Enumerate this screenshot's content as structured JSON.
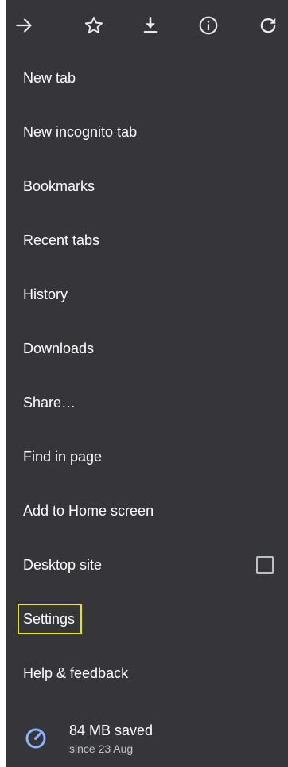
{
  "toolbar": {
    "icons": [
      "forward-arrow-icon",
      "star-icon",
      "download-icon",
      "info-icon",
      "reload-icon"
    ]
  },
  "menu": {
    "items": [
      {
        "label": "New tab"
      },
      {
        "label": "New incognito tab"
      },
      {
        "label": "Bookmarks"
      },
      {
        "label": "Recent tabs"
      },
      {
        "label": "History"
      },
      {
        "label": "Downloads"
      },
      {
        "label": "Share…"
      },
      {
        "label": "Find in page"
      },
      {
        "label": "Add to Home screen"
      },
      {
        "label": "Desktop site",
        "checked": false
      },
      {
        "label": "Settings"
      },
      {
        "label": "Help & feedback"
      }
    ]
  },
  "data_saver": {
    "title": "84 MB saved",
    "subtitle": "since 23 Aug",
    "icon": "speedometer-icon"
  },
  "colors": {
    "menu_background": "#36363a",
    "text": "#ffffff",
    "highlight_border": "#e8e51a",
    "accent": "#8ab4f8"
  }
}
